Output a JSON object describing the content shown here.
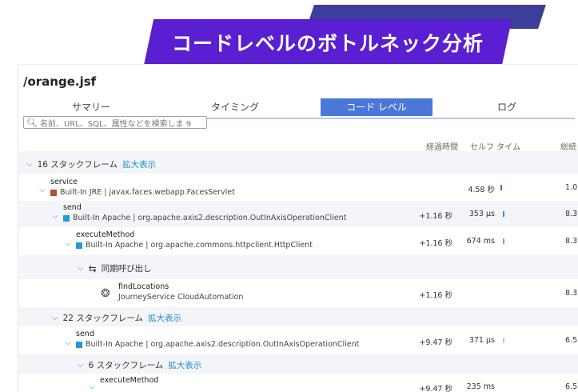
{
  "banner": {
    "title": "コードレベルのボトルネック分析"
  },
  "page_title": "/orange.jsf",
  "tabs": [
    {
      "label": "サマリー"
    },
    {
      "label": "タイミング"
    },
    {
      "label": "コード レベル",
      "active": true
    },
    {
      "label": "ログ"
    }
  ],
  "search": {
    "placeholder": "名前、URL、SQL、属性などを検索しま 9"
  },
  "columns": {
    "elapsed": "経過時間",
    "self_time": "セルフ タイム",
    "total_cut": "総続"
  },
  "expand_label": "拡大表示",
  "frames": {
    "f1": "16 スタックフレーム",
    "f2": "22 スタックフレーム",
    "f3": "6 スタックフレーム"
  },
  "sync_call": "同期呼び出し",
  "nodes": [
    {
      "name": "service",
      "sub": "Built-In JRE | javax.faces.webapp.FacesServlet",
      "elapsed": "",
      "self": "4.58 秒",
      "total": "1.0"
    },
    {
      "name": "send",
      "sub": "Built-In Apache | org.apache.axis2.description.OutInAxisOperationClient",
      "elapsed": "+1.16 秒",
      "self": "353 μs",
      "total": "8.3"
    },
    {
      "name": "executeMethod",
      "sub": "Built-In Apache | org.apache.commons.httpclient.HttpClient",
      "elapsed": "+1.16 秒",
      "self": "674 ms",
      "total": "8.3"
    },
    {
      "name": "findLocations",
      "sub": "JourneyService CloudAutomation",
      "elapsed": "+1.16 秒",
      "self": "",
      "total": "8.3"
    },
    {
      "name": "send",
      "sub": "Built-In Apache | org.apache.axis2.description.OutInAxisOperationClient",
      "elapsed": "+9.47 秒",
      "self": "371 μs",
      "total": "6.5"
    },
    {
      "name": "executeMethod",
      "sub": "",
      "elapsed": "+9.47 秒",
      "self": "235 ms",
      "total": "6.5"
    }
  ],
  "colors": {
    "banner": "#5a1fd0",
    "banner_strip": "#3b3f9a",
    "tab_active": "#4a78d8",
    "jre": "#b3512b",
    "apache": "#1e9be0",
    "link": "#1a8ec9"
  },
  "icons": {
    "search": "search-icon",
    "chevron": "chevron-down-icon",
    "sync": "sync-arrows-icon",
    "service": "bug-icon"
  }
}
